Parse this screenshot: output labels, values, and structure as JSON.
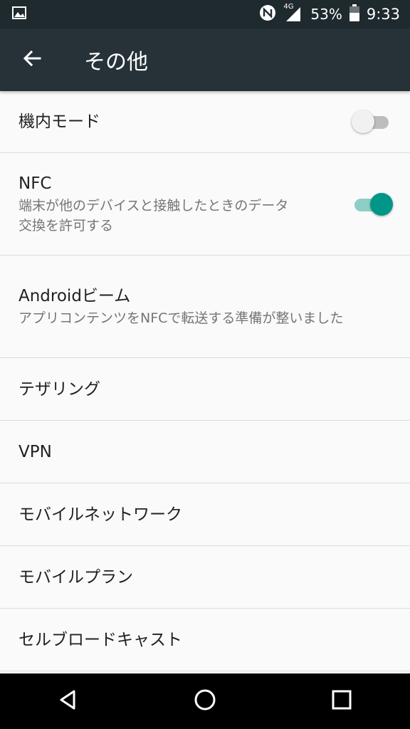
{
  "status_bar": {
    "battery_percent": "53%",
    "time": "9:33",
    "network_label": "4G",
    "icons": [
      "gallery-icon",
      "nfc-icon",
      "signal-icon",
      "battery-icon"
    ]
  },
  "app_bar": {
    "title": "その他",
    "back_icon": "arrow-back-icon"
  },
  "settings": [
    {
      "title": "機内モード",
      "toggle": false
    },
    {
      "title": "NFC",
      "summary": "端末が他のデバイスと接触したときのデータ交換を許可する",
      "toggle": true
    },
    {
      "title": "Androidビーム",
      "summary": "アプリコンテンツをNFCで転送する準備が整いました"
    },
    {
      "title": "テザリング"
    },
    {
      "title": "VPN"
    },
    {
      "title": "モバイルネットワーク"
    },
    {
      "title": "モバイルプラン"
    },
    {
      "title": "セルブロードキャスト"
    }
  ],
  "nav_bar": {
    "icons": [
      "back-triangle-icon",
      "home-circle-icon",
      "recents-square-icon"
    ]
  },
  "colors": {
    "status_bar": "#1f2a2f",
    "app_bar": "#263238",
    "accent": "#009688",
    "accent_track": "#8dcfc7"
  }
}
